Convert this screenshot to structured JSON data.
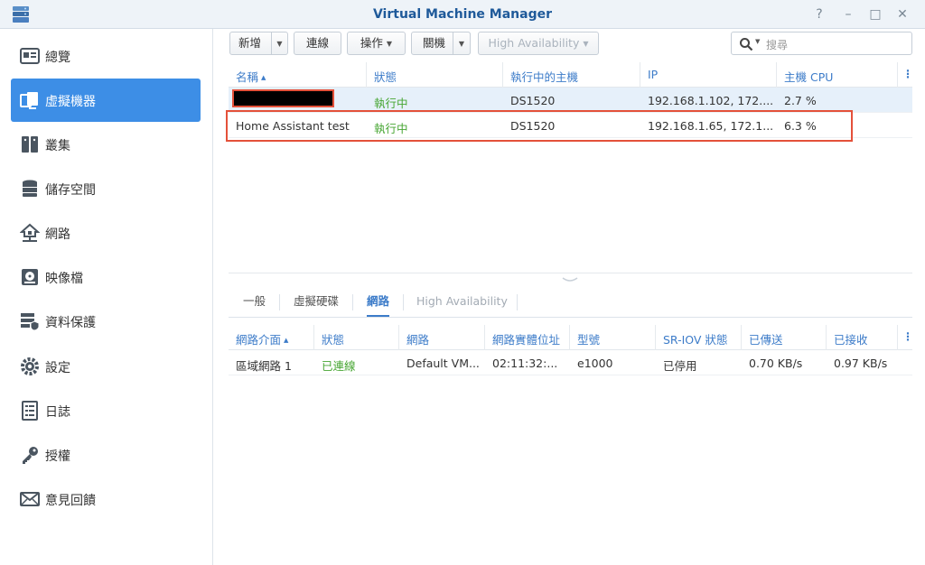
{
  "window": {
    "title": "Virtual Machine Manager",
    "controls": [
      "?",
      "–",
      "□",
      "✕"
    ]
  },
  "sidebar": {
    "items": [
      {
        "label": "總覽",
        "icon": "overview-icon",
        "active": false
      },
      {
        "label": "虛擬機器",
        "icon": "virtual-machine-icon",
        "active": true
      },
      {
        "label": "叢集",
        "icon": "cluster-icon",
        "active": false
      },
      {
        "label": "儲存空間",
        "icon": "storage-icon",
        "active": false
      },
      {
        "label": "網路",
        "icon": "network-icon",
        "active": false
      },
      {
        "label": "映像檔",
        "icon": "image-icon",
        "active": false
      },
      {
        "label": "資料保護",
        "icon": "data-protection-icon",
        "active": false
      },
      {
        "label": "設定",
        "icon": "settings-icon",
        "active": false
      },
      {
        "label": "日誌",
        "icon": "log-icon",
        "active": false
      },
      {
        "label": "授權",
        "icon": "license-icon",
        "active": false
      },
      {
        "label": "意見回饋",
        "icon": "feedback-icon",
        "active": false
      }
    ]
  },
  "toolbar": {
    "create_label": "新增",
    "connect_label": "連線",
    "action_label": "操作",
    "shutdown_label": "關機",
    "ha_label": "High Availability",
    "search_placeholder": "搜尋"
  },
  "vm_table": {
    "columns": [
      "名稱",
      "狀態",
      "執行中的主機",
      "IP",
      "主機 CPU"
    ],
    "rows": [
      {
        "name": "",
        "status": "執行中",
        "host": "DS1520",
        "ip": "192.168.1.102, 172....",
        "cpu": "2.7 %"
      },
      {
        "name": "Home Assistant test",
        "status": "執行中",
        "host": "DS1520",
        "ip": "192.168.1.65, 172.1...",
        "cpu": "6.3 %"
      }
    ]
  },
  "detail_tabs": [
    "一般",
    "虛擬硬碟",
    "網路",
    "High Availability"
  ],
  "nic_table": {
    "columns": [
      "網路介面",
      "狀態",
      "網路",
      "網路實體位址",
      "型號",
      "SR-IOV 狀態",
      "已傳送",
      "已接收"
    ],
    "rows": [
      {
        "interface": "區域網路 1",
        "status": "已連線",
        "network": "Default VM...",
        "mac": "02:11:32:...",
        "model": "e1000",
        "sriov": "已停用",
        "sent": "0.70 KB/s",
        "received": "0.97 KB/s"
      }
    ]
  },
  "colors": {
    "accent": "#3d8ee6",
    "running_green": "#47a633",
    "highlight_red": "#e4513a"
  }
}
